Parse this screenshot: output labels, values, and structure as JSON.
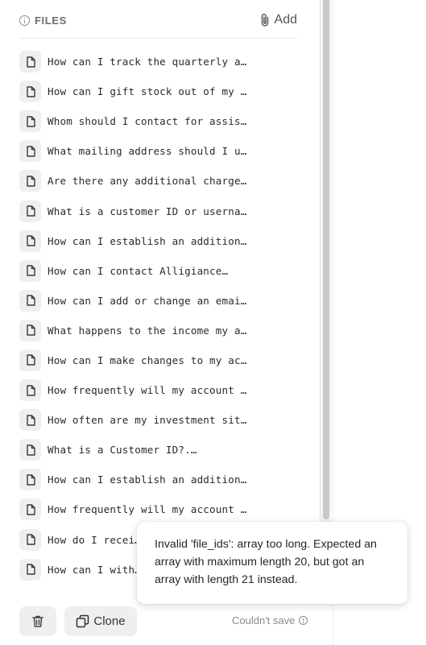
{
  "header": {
    "title": "FILES",
    "add_label": "Add"
  },
  "files": [
    {
      "name": "How can I track the quarterly a…"
    },
    {
      "name": "How can I gift stock out of my …"
    },
    {
      "name": "Whom should I contact for assis…"
    },
    {
      "name": "What mailing address should I u…"
    },
    {
      "name": "Are there any additional charge…"
    },
    {
      "name": "What is a customer ID or userna…"
    },
    {
      "name": "How can I establish an addition…"
    },
    {
      "name": "How can I contact Alligiance…"
    },
    {
      "name": "How can I add or change an emai…"
    },
    {
      "name": "What happens to the income my a…"
    },
    {
      "name": "How can I make changes to my ac…"
    },
    {
      "name": "How frequently will my account …"
    },
    {
      "name": "How often are my investment sit…"
    },
    {
      "name": "What is a Customer ID?.…"
    },
    {
      "name": "How can I establish an addition…"
    },
    {
      "name": "How frequently will my account …"
    },
    {
      "name": "How do I recei…"
    },
    {
      "name": "How can I with…"
    }
  ],
  "bottom": {
    "clone_label": "Clone",
    "save_status": "Couldn't save"
  },
  "tooltip": {
    "message": "Invalid 'file_ids': array too long. Expected an array with maximum length 20, but got an array with length 21 instead."
  },
  "icons": {
    "info": "info-icon",
    "add": "paperclip-icon",
    "file": "file-icon",
    "delete": "trash-icon",
    "clone": "copy-icon"
  }
}
